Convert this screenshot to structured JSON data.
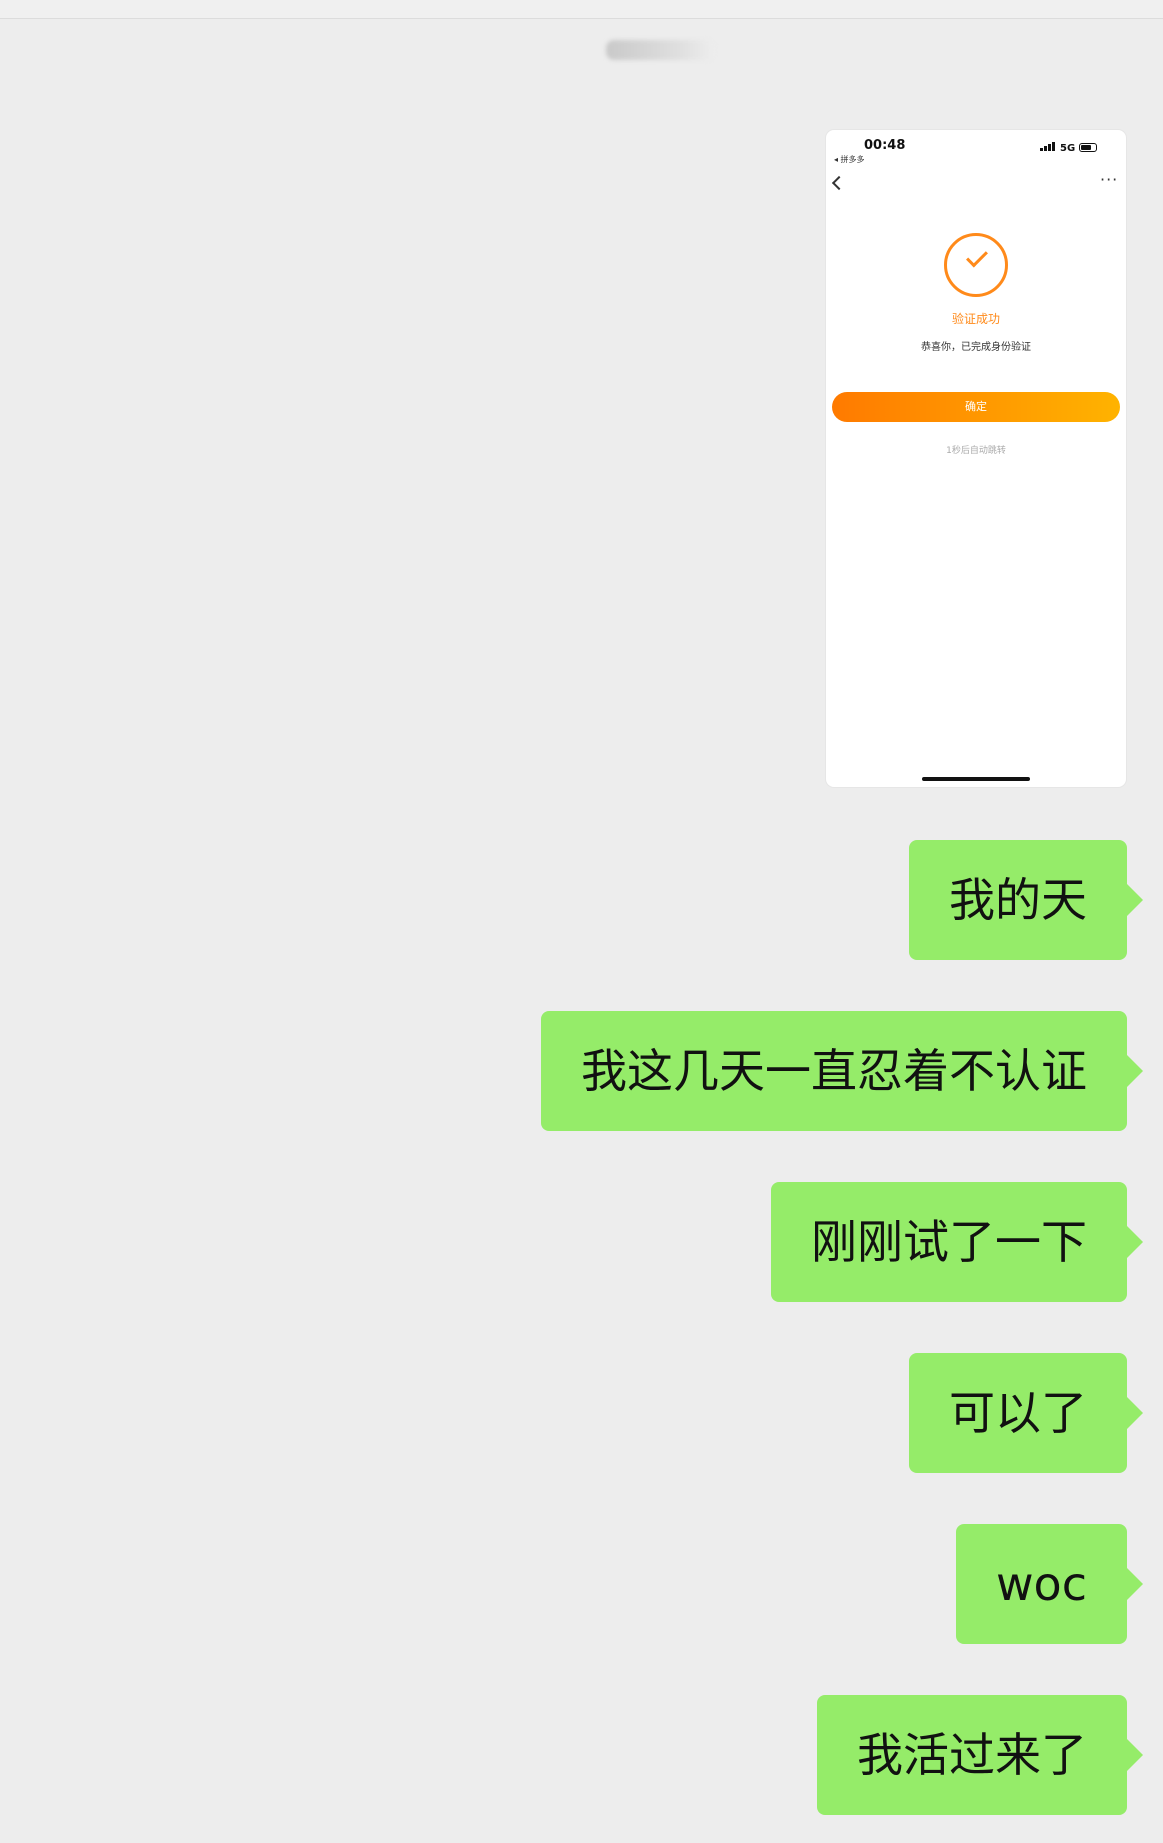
{
  "image_message": {
    "status_time": "00:48",
    "back_app": "◂ 拼多多",
    "network": "5G",
    "success_title": "验证成功",
    "success_desc": "恭喜你，已完成身份验证",
    "confirm_label": "确定",
    "redirect_text": "1秒后自动跳转"
  },
  "messages": [
    {
      "text": "我的天"
    },
    {
      "text": "我这几天一直忍着不认证"
    },
    {
      "text": "刚刚试了一下"
    },
    {
      "text": "可以了"
    },
    {
      "text": "woc"
    },
    {
      "text": "我活过来了"
    }
  ],
  "colors": {
    "bubble_green": "#95ec69",
    "background": "#ededed",
    "accent_orange": "#ff8a1a"
  }
}
